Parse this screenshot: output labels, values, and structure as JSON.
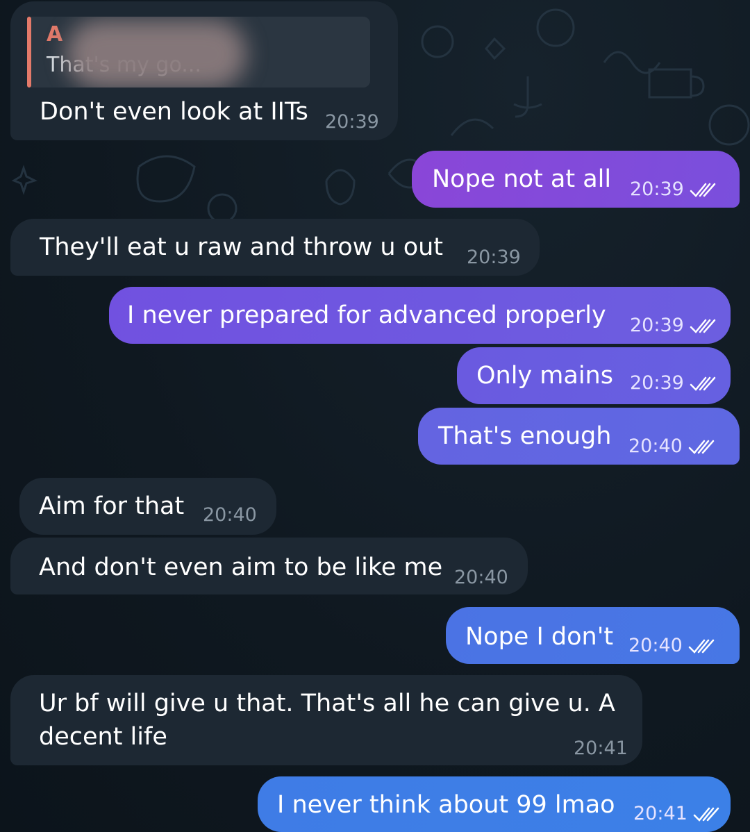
{
  "messages": [
    {
      "id": "m1",
      "dir": "in",
      "reply": {
        "name": "A",
        "text": "That's my go..."
      },
      "text": "Don't even look at IITs",
      "time": "20:39"
    },
    {
      "id": "m2",
      "dir": "out",
      "text": "Nope not at all",
      "time": "20:39"
    },
    {
      "id": "m3",
      "dir": "in",
      "text": "They'll eat u raw and throw u out",
      "time": "20:39"
    },
    {
      "id": "m4",
      "dir": "out",
      "text": "I never prepared for advanced properly",
      "time": "20:39"
    },
    {
      "id": "m5",
      "dir": "out",
      "text": "Only mains",
      "time": "20:39"
    },
    {
      "id": "m6",
      "dir": "out",
      "text": "That's enough",
      "time": "20:40"
    },
    {
      "id": "m7",
      "dir": "in",
      "text": "Aim for that",
      "time": "20:40"
    },
    {
      "id": "m8",
      "dir": "in",
      "text": "And don't even aim to be like me",
      "time": "20:40"
    },
    {
      "id": "m9",
      "dir": "out",
      "text": "Nope I don't",
      "time": "20:40"
    },
    {
      "id": "m10",
      "dir": "in",
      "text_lines": [
        "Ur bf will give u that. That's all he can give u. A",
        "decent life"
      ],
      "time": "20:41"
    },
    {
      "id": "m11",
      "dir": "out",
      "text": "I never think about 99 lmao",
      "time": "20:41"
    }
  ],
  "colors": {
    "incoming_bubble": "#1d2833",
    "outgoing_gradient": [
      "#8a46d8",
      "#6c5ee0",
      "#3f7ce6"
    ],
    "reply_accent": "#e47a6a"
  },
  "icons": {
    "read_status": "double-check-icon"
  }
}
